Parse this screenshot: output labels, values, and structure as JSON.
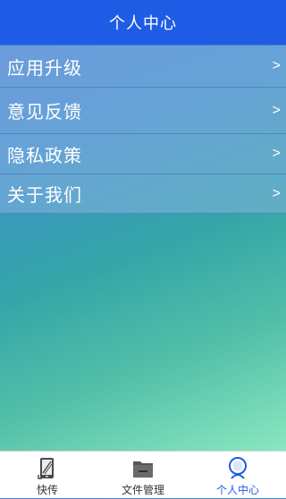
{
  "header": {
    "title": "个人中心"
  },
  "menu": {
    "items": [
      {
        "label": "应用升级",
        "chevron": ">"
      },
      {
        "label": "意见反馈",
        "chevron": ">"
      },
      {
        "label": "隐私政策",
        "chevron": ">"
      },
      {
        "label": "关于我们",
        "chevron": ">"
      }
    ]
  },
  "tabs": [
    {
      "label": "快传",
      "icon": "phone-transfer-icon",
      "active": false
    },
    {
      "label": "文件管理",
      "icon": "folder-icon",
      "active": false
    },
    {
      "label": "个人中心",
      "icon": "person-icon",
      "active": true
    }
  ],
  "colors": {
    "header": "#1f5ce6",
    "active_tab": "#1f5ce6",
    "text": "#ffffff"
  }
}
